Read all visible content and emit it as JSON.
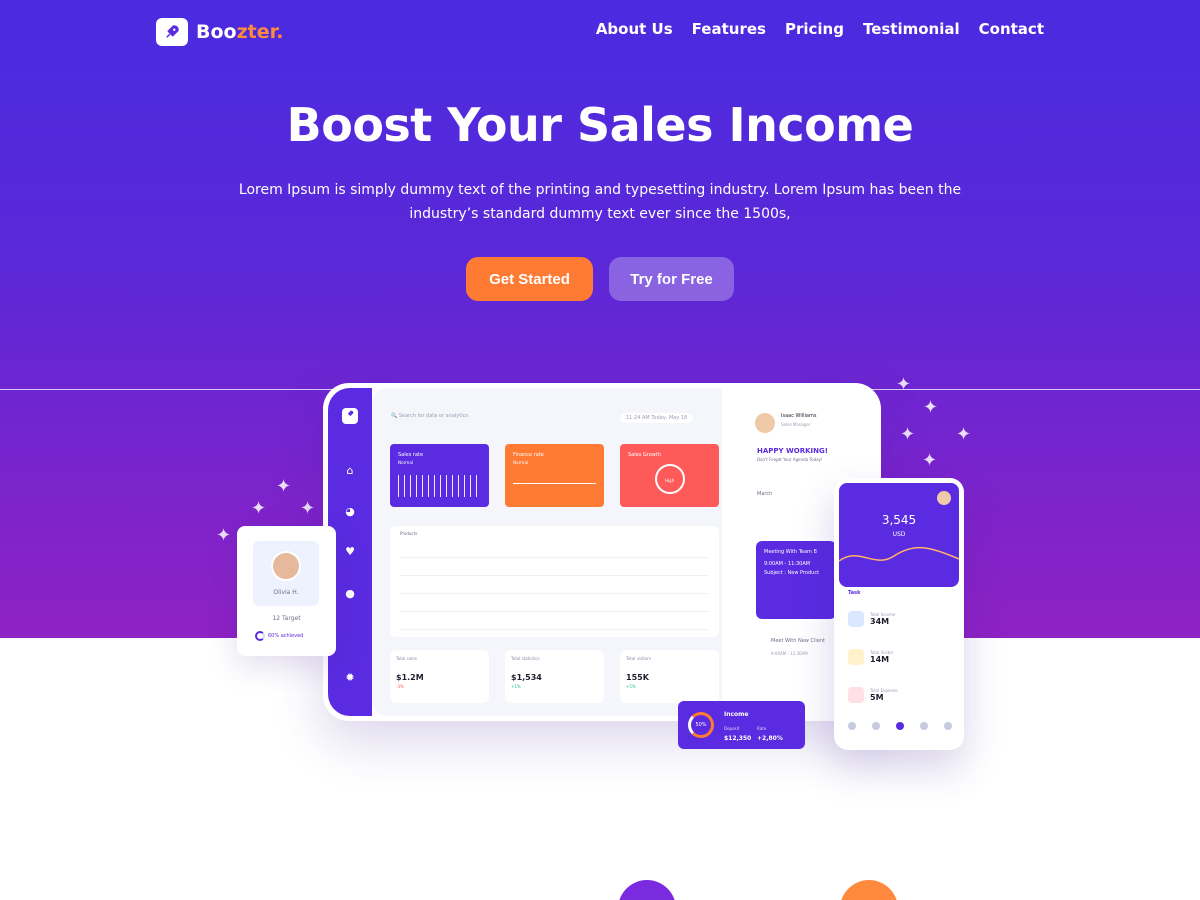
{
  "brand": {
    "name_main": "Boo",
    "name_accent": "zter."
  },
  "nav": {
    "items": [
      "About Us",
      "Features",
      "Pricing",
      "Testimonial",
      "Contact"
    ]
  },
  "hero": {
    "title": "Boost Your Sales Income",
    "subtitle": "Lorem Ipsum is simply dummy text of the printing and typesetting industry. Lorem Ipsum has been the industry’s standard dummy text ever since the 1500s,",
    "primary_button": "Get Started",
    "secondary_button": "Try for Free"
  },
  "colors": {
    "primary": "#5a2be0",
    "accent": "#ff7a33",
    "danger": "#ff5a5a"
  },
  "dashboard": {
    "search_placeholder": "Search for data or analytics",
    "time": "11:24 AM   Today, May 18",
    "kpis": [
      {
        "label": "Sales rate",
        "sub": "Normal"
      },
      {
        "label": "Finance rate",
        "sub": "Normal"
      },
      {
        "label": "Sales Growth",
        "sub": "High"
      }
    ],
    "table_title": "Products",
    "stats": [
      {
        "label": "Total sales",
        "value": "$1.2M",
        "change": "-3%"
      },
      {
        "label": "Total statistics",
        "value": "$1,534",
        "change": "+1%"
      },
      {
        "label": "Total visitors",
        "value": "155K",
        "change": "+5%"
      }
    ],
    "user": {
      "name": "Isaac Williams",
      "role": "Sales Manager"
    },
    "greeting": "HAPPY WORKING!",
    "greeting_sub": "Don't Forget Your Agenda Today!",
    "month": "March",
    "meeting": {
      "title": "Meeting With Team B",
      "time": "9:00AM - 11:30AM",
      "subject": "Subject : New Product"
    },
    "meeting2": {
      "title": "Meet With New Client",
      "time": "9:00AM - 11:30AM"
    }
  },
  "phone": {
    "amount": "3,545",
    "currency": "USD",
    "task_label": "Task",
    "tasks": [
      {
        "label": "Total Income",
        "value": "34M"
      },
      {
        "label": "Total Visitor",
        "value": "14M"
      },
      {
        "label": "Total Expense",
        "value": "5M"
      }
    ]
  },
  "profile": {
    "name": "Olivia H.",
    "target": "12 Target",
    "achieved": "60% achieved"
  },
  "income": {
    "title": "Income",
    "percent": "50%",
    "deposit_label": "Deposit",
    "deposit": "$12,350",
    "rate_label": "Rate",
    "rate": "+2,80%"
  }
}
